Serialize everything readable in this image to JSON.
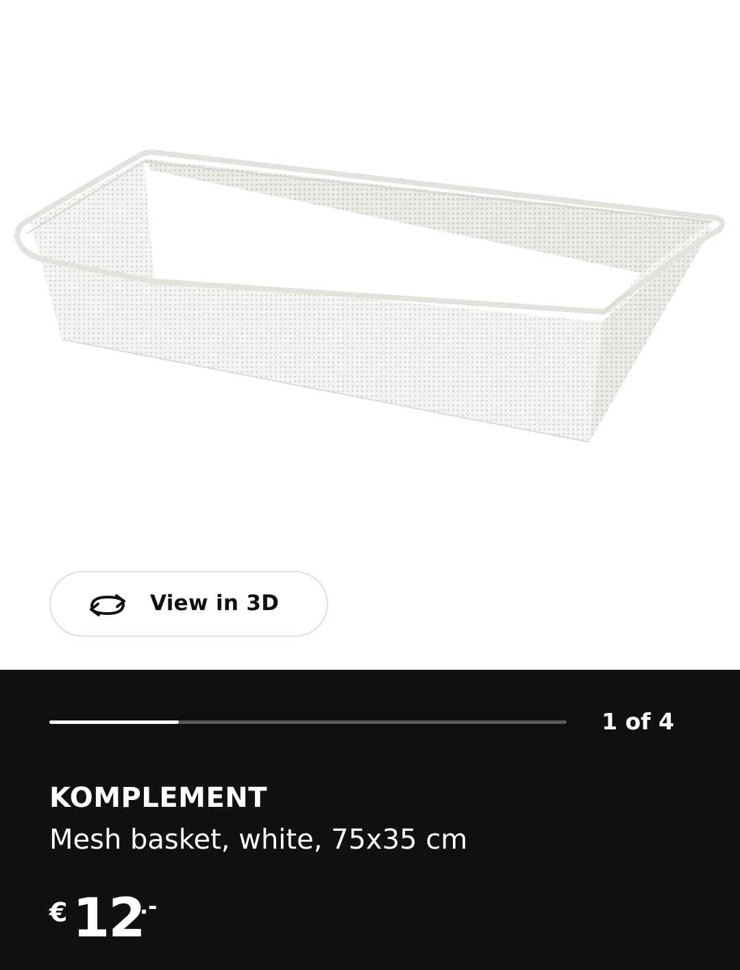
{
  "view3d": {
    "label": "View in 3D",
    "icon": "rotate-3d-icon"
  },
  "gallery": {
    "counter": "1 of 4",
    "progress": 0.25
  },
  "product": {
    "name": "KOMPLEMENT",
    "description": "Mesh basket, white, 75x35 cm",
    "price": {
      "currency": "€",
      "amount": "12",
      "decimals": ".-"
    }
  },
  "colors": {
    "panel_background": "#111111",
    "progress_track": "#5a5a5a",
    "progress_fill": "#ffffff",
    "text_light": "#ffffff",
    "text_dark": "#111111"
  }
}
